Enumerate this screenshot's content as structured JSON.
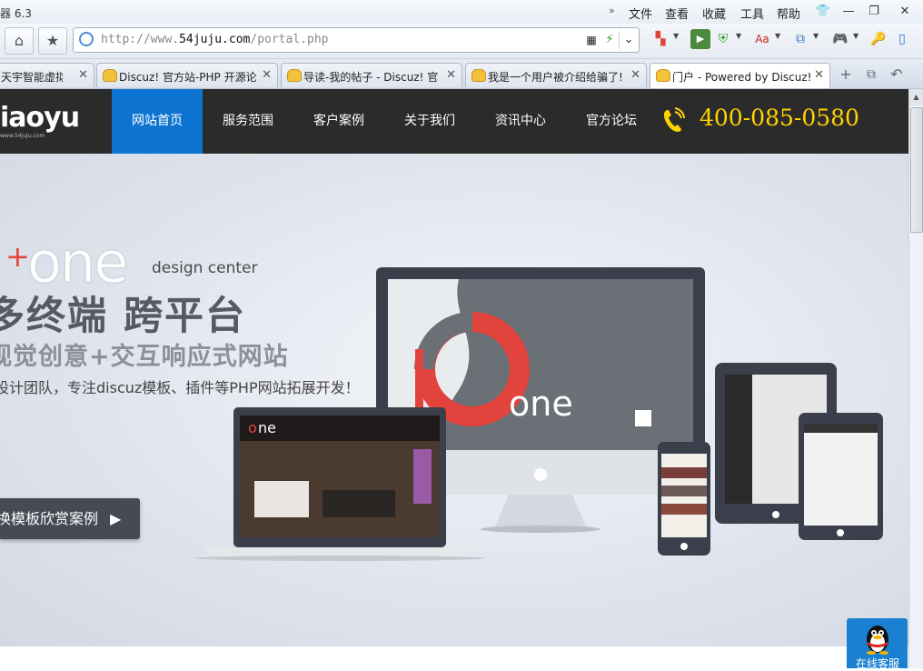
{
  "browser": {
    "title_fragment": "器 6.3",
    "menu": [
      "文件",
      "查看",
      "收藏",
      "工具",
      "帮助"
    ],
    "address": {
      "scheme": "http://www.",
      "domain": "54juju.com",
      "path": "/portal.php"
    },
    "tabs": [
      {
        "label": "天宇智能虚拟主",
        "active": false
      },
      {
        "label": "Discuz! 官方站-PHP 开源论",
        "active": false
      },
      {
        "label": "导读-我的帖子 - Discuz! 官",
        "active": false
      },
      {
        "label": "我是一个用户被介绍给骗了!",
        "active": false
      },
      {
        "label": "门户 - Powered by Discuz!",
        "active": true
      }
    ]
  },
  "site": {
    "logo": "iaoyu",
    "logo_sub": "www.54juju.com",
    "nav": [
      "网站首页",
      "服务范围",
      "客户案例",
      "关于我们",
      "资讯中心",
      "官方论坛"
    ],
    "phone": "400-085-0580"
  },
  "banner": {
    "brand": "one",
    "brand_plus": "+",
    "brand_tag": "design center",
    "headline": "多终端 跨平台",
    "subline": "视觉创意+交互响应式网站",
    "description": "设计团队，专注discuz模板、插件等PHP网站拓展开发！",
    "button_label": "换模板欣赏案例",
    "button_arrow": "▶"
  },
  "widget": {
    "online_label": "在线客服"
  },
  "colors": {
    "nav_bg": "#2b2b2b",
    "nav_active": "#0d74d1",
    "phone": "#ffd200",
    "brand_red": "#e2433c",
    "online_bg": "#1b80d1"
  }
}
